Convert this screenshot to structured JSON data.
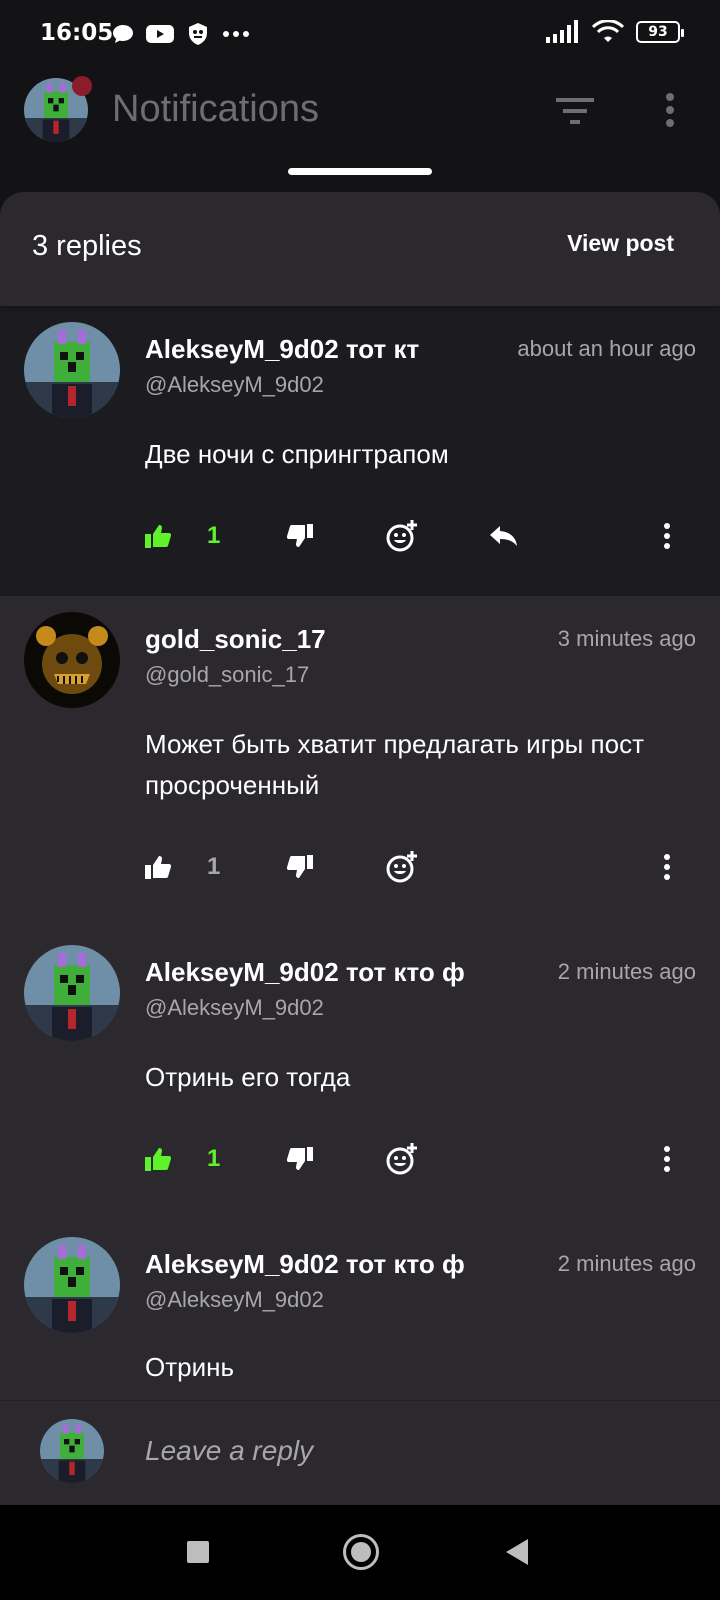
{
  "status_bar": {
    "time": "16:05",
    "battery": "93"
  },
  "app_bar": {
    "title": "Notifications"
  },
  "sheet": {
    "title": "3 replies",
    "view_post_label": "View post"
  },
  "comments": [
    {
      "name": "AlekseyM_9d02 тот кт",
      "handle": "@AlekseyM_9d02",
      "time": "about an hour ago",
      "text": "Две ночи с спрингтрапом",
      "likes": "1",
      "liked": true,
      "avatar": "creeper"
    },
    {
      "name": "gold_sonic_17",
      "handle": "@gold_sonic_17",
      "time": "3 minutes ago",
      "text": "Может быть хватит предлагать игры пост просроченный",
      "likes": "1",
      "liked": false,
      "avatar": "golden-bear"
    },
    {
      "name": "AlekseyM_9d02 тот кто ф",
      "handle": "@AlekseyM_9d02",
      "time": "2 minutes ago",
      "text": "Отринь его тогда",
      "likes": "1",
      "liked": true,
      "avatar": "creeper"
    },
    {
      "name": "AlekseyM_9d02 тот кто ф",
      "handle": "@AlekseyM_9d02",
      "time": "2 minutes ago",
      "text": "Отринь",
      "avatar": "creeper"
    }
  ],
  "reply_bar": {
    "placeholder": "Leave a reply"
  },
  "colors": {
    "liked": "#5ff22a",
    "background": "#2b282e",
    "first_comment_bg": "#1c1b1f",
    "muted": "#a8a6ad"
  }
}
